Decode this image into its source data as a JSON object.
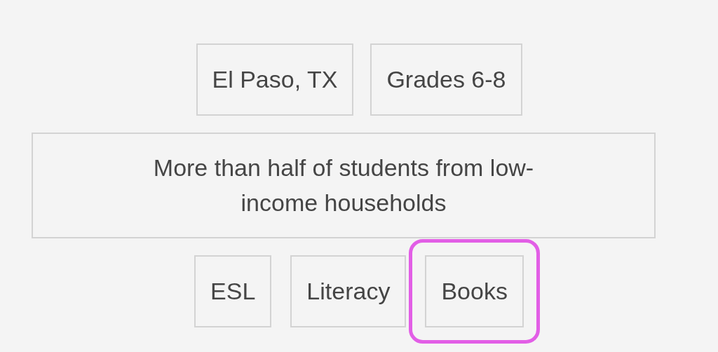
{
  "rows": [
    {
      "tags": [
        {
          "kind": "tag",
          "label": "El Paso, TX",
          "highlighted": false
        },
        {
          "kind": "tag",
          "label": "Grades 6-8",
          "highlighted": false
        }
      ]
    },
    {
      "tags": [
        {
          "kind": "statement",
          "label": "More than half of students from low-income households",
          "highlighted": false
        }
      ]
    },
    {
      "tags": [
        {
          "kind": "tag",
          "label": "ESL",
          "highlighted": false
        },
        {
          "kind": "tag",
          "label": "Literacy",
          "highlighted": false
        },
        {
          "kind": "tag",
          "label": "Books",
          "highlighted": true
        }
      ]
    }
  ]
}
